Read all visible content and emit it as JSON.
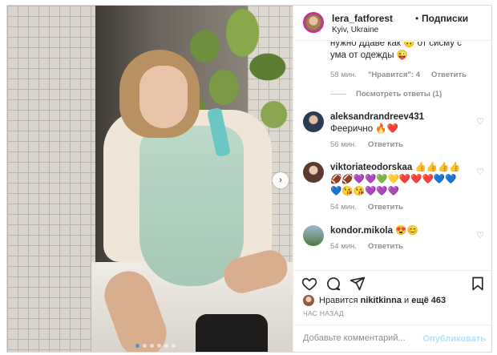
{
  "header": {
    "username": "lera_fatforest",
    "bullet": "•",
    "follow_label": "Подписки",
    "location": "Kyiv, Ukraine"
  },
  "comments": {
    "clipped_line": "нужно ддаве как 🙃 от сисму с",
    "first": {
      "text": "ума от одежды 😜",
      "time": "58 мин.",
      "likes": "\"Нравится\": 4",
      "reply_label": "Ответить",
      "view_replies": "Посмотреть ответы (1)"
    },
    "items": [
      {
        "user": "aleksandrandreev431",
        "text": "Феерично 🔥❤️",
        "time": "56 мин.",
        "reply_label": "Ответить"
      },
      {
        "user": "viktoriateodorskaa",
        "text": "👍👍👍👍🏈🏈💜💜💚💛❤️❤️❤️💙💙💙😘😘💜💜💜",
        "time": "54 мин.",
        "reply_label": "Ответить"
      },
      {
        "user": "kondor.mikola",
        "text": "😍😊",
        "time": "54 мин.",
        "reply_label": "Ответить"
      }
    ]
  },
  "likes": {
    "prefix": "Нравится",
    "user": "nikitkinna",
    "conj": "и",
    "others": "ещё 463"
  },
  "timestamp": "час назад",
  "add_comment": {
    "placeholder": "Добавьте комментарий...",
    "publish_label": "Опубликовать"
  },
  "carousel": {
    "slide_count": 6,
    "active_index": 0
  },
  "colors": {
    "accent": "#3897f0",
    "publish_disabled": "#b2dffc",
    "muted": "#8e8e8e"
  }
}
